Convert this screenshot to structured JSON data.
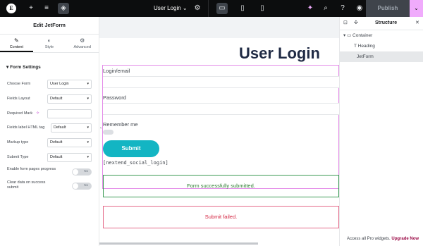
{
  "topbar": {
    "logo": "E",
    "page_title": "User Login",
    "publish": "Publish",
    "icons": [
      "plus-icon",
      "sliders-icon",
      "layers-icon",
      "gear-icon",
      "desktop-icon",
      "tablet-icon",
      "mobile-icon",
      "sparkle-icon",
      "search-icon",
      "help-icon",
      "eye-icon",
      "chevron-down-icon"
    ]
  },
  "left": {
    "title": "Edit JetForm",
    "tabs": [
      "Content",
      "Style",
      "Advanced"
    ],
    "section": "Form Settings",
    "fields": [
      {
        "label": "Choose Form",
        "value": "User Login"
      },
      {
        "label": "Fields Layout",
        "value": "Default"
      },
      {
        "label": "Required Mark",
        "value": ""
      },
      {
        "label": "Fields label HTML tag",
        "value": "Default"
      },
      {
        "label": "Markup type",
        "value": "Default"
      },
      {
        "label": "Submit Type",
        "value": "Default"
      },
      {
        "label": "Enable form pages progress",
        "value": "No"
      },
      {
        "label": "Clear data on success submit",
        "value": "No"
      }
    ]
  },
  "canvas": {
    "heading": "User Login",
    "login_label": "Login/email",
    "password_label": "Password",
    "remember_label": "Remember me",
    "submit": "Submit",
    "shortcode": "[nextend_social_login]",
    "success_msg": "Form successfully submitted.",
    "fail_msg": "Submit failed."
  },
  "right": {
    "title": "Structure",
    "tree": [
      "Container",
      "Heading",
      "JetForm"
    ],
    "promo_text": "Access all Pro widgets.",
    "promo_link": "Upgrade Now"
  },
  "colors": {
    "accent": "#13b5c3",
    "pink": "#f0abfc",
    "success": "#3d9b56",
    "error": "#e56b8a"
  }
}
